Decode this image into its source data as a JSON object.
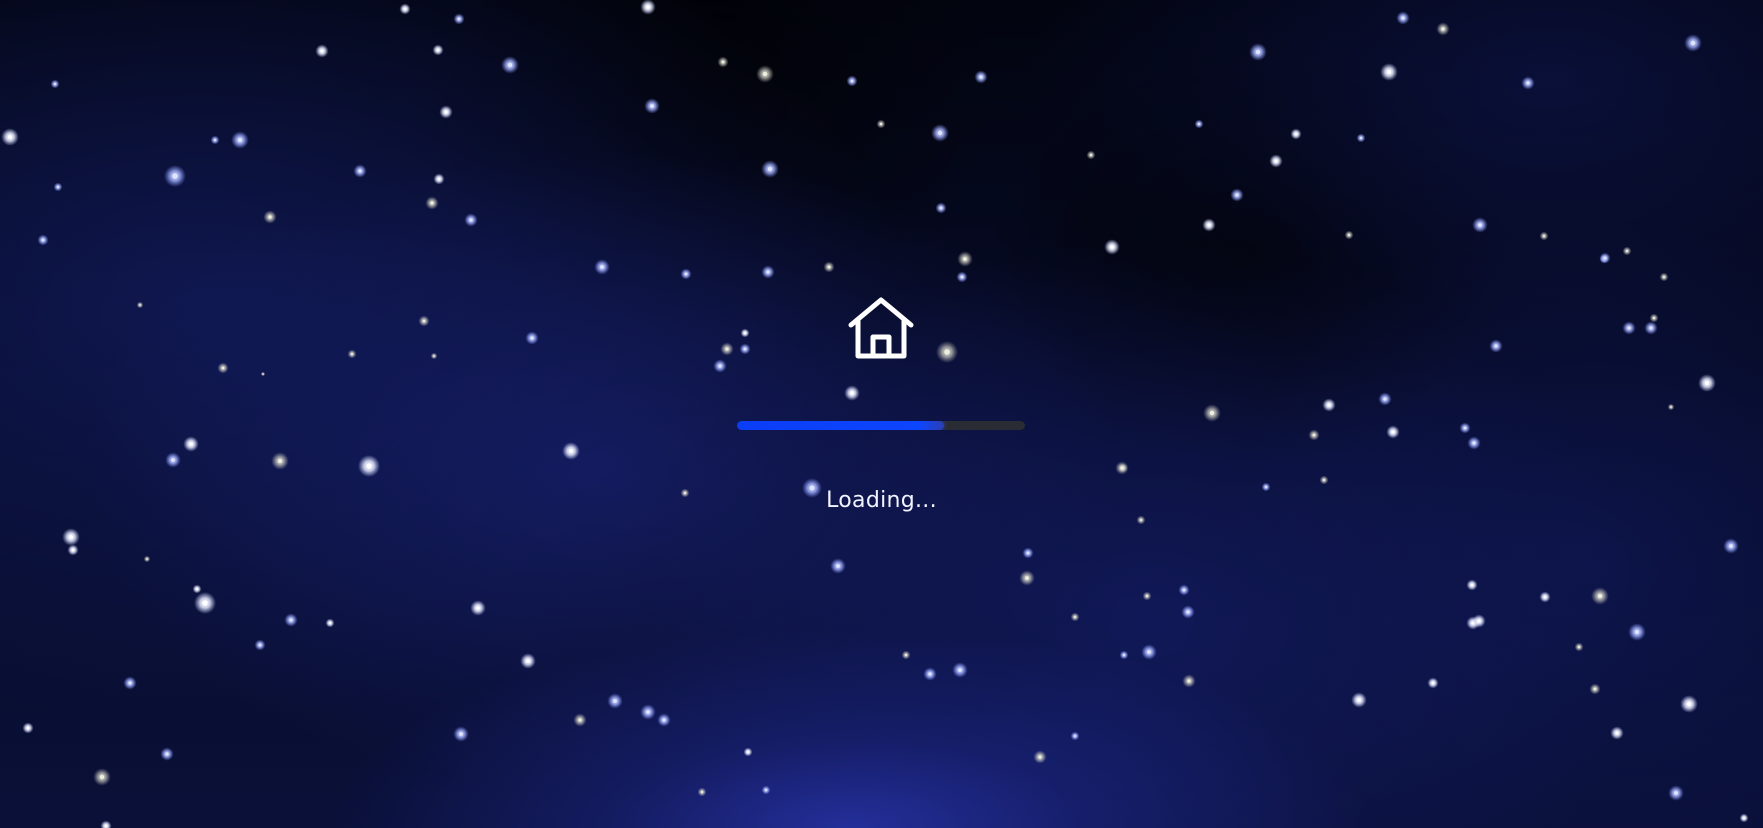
{
  "loading_screen": {
    "icon": "home-icon",
    "status_text": "Loading...",
    "progress": 0.72,
    "colors": {
      "progress_fill": "#0d46ff",
      "progress_track": "#2a2c33",
      "text": "#f2f4ff",
      "background": "#060a24"
    }
  }
}
